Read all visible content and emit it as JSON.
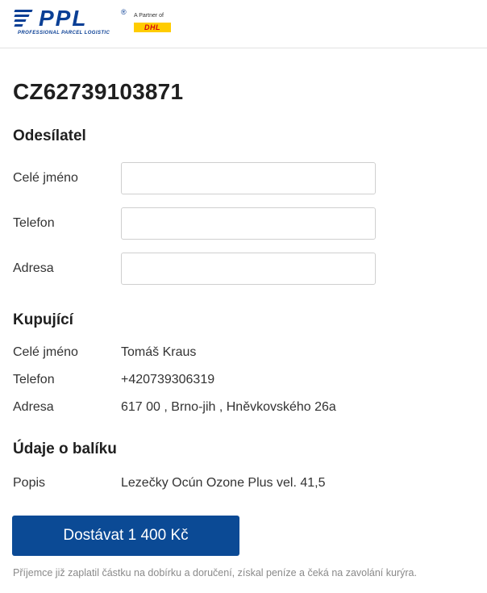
{
  "header": {
    "logo_text": "PPL",
    "logo_registered": "®",
    "logo_tagline": "PROFESSIONAL PARCEL LOGISTIC",
    "partner_label": "A Partner of",
    "partner_brand": "DHL",
    "colors": {
      "brand_blue": "#0a3f95",
      "dhl_yellow": "#ffcc00",
      "dhl_red": "#d40511"
    }
  },
  "tracking_number": "CZ62739103871",
  "sender": {
    "title": "Odesílatel",
    "fields": [
      {
        "label": "Celé jméno",
        "value": ""
      },
      {
        "label": "Telefon",
        "value": ""
      },
      {
        "label": "Adresa",
        "value": ""
      }
    ]
  },
  "buyer": {
    "title": "Kupující",
    "fields": [
      {
        "label": "Celé jméno",
        "value": "Tomáš Kraus"
      },
      {
        "label": "Telefon",
        "value": "+420739306319"
      },
      {
        "label": "Adresa",
        "value": "617 00 , Brno-jih , Hněvkovského 26a"
      }
    ]
  },
  "package": {
    "title": "Údaje o balíku",
    "fields": [
      {
        "label": "Popis",
        "value": "Lezečky Ocún Ozone Plus vel. 41,5"
      }
    ]
  },
  "action": {
    "button_label": "Dostávat 1 400 Kč",
    "button_color": "#0b4a95"
  },
  "footnote": "Příjemce již zaplatil částku na dobírku a doručení, získal peníze a čeká na zavolání kurýra."
}
